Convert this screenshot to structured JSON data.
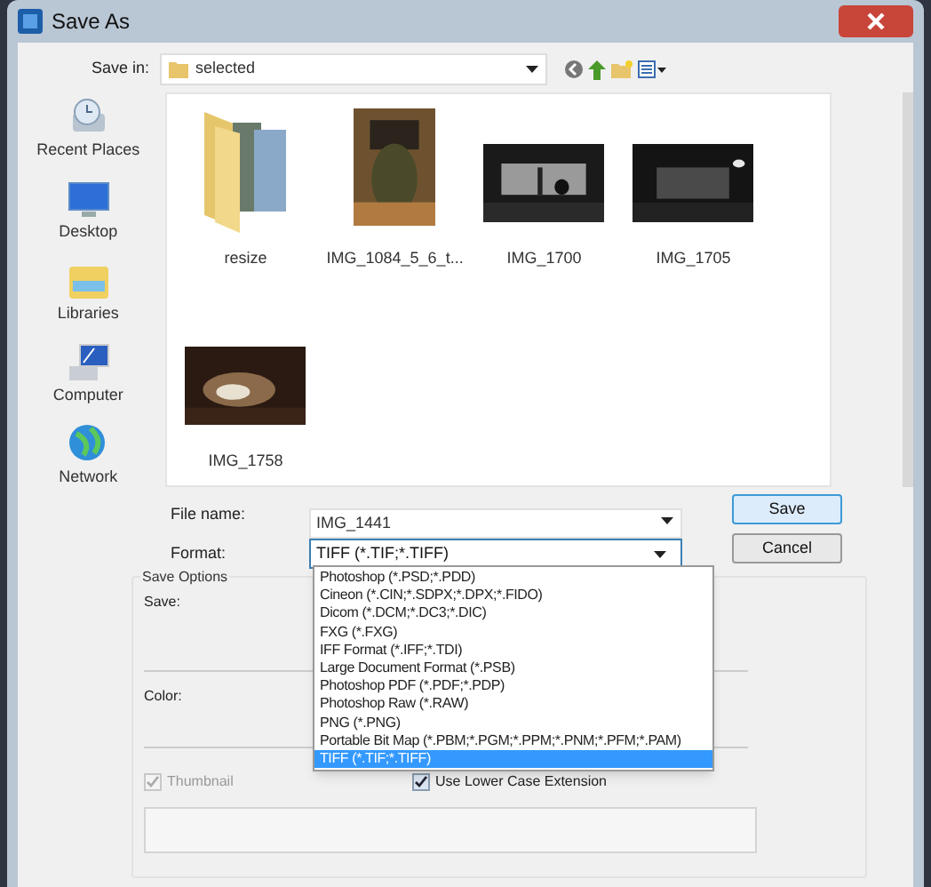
{
  "window": {
    "title": "Save As"
  },
  "save_in": {
    "label": "Save in:",
    "value": "selected"
  },
  "places": [
    {
      "label": "Recent Places",
      "kind": "recent"
    },
    {
      "label": "Desktop",
      "kind": "desktop"
    },
    {
      "label": "Libraries",
      "kind": "libraries"
    },
    {
      "label": "Computer",
      "kind": "computer"
    },
    {
      "label": "Network",
      "kind": "network"
    }
  ],
  "files": [
    {
      "name": "resize",
      "kind": "folder"
    },
    {
      "name": "IMG_1084_5_6_t...",
      "kind": "portrait"
    },
    {
      "name": "IMG_1700",
      "kind": "landscape"
    },
    {
      "name": "IMG_1705",
      "kind": "landscape"
    },
    {
      "name": "IMG_1758",
      "kind": "landscape"
    }
  ],
  "file_name": {
    "label": "File name:",
    "value": "IMG_1441"
  },
  "format": {
    "label": "Format:",
    "value": "TIFF (*.TIF;*.TIFF)",
    "expanded": true,
    "options": [
      {
        "label": "Photoshop (*.PSD;*.PDD)",
        "selected": false
      },
      {
        "label": "Cineon (*.CIN;*.SDPX;*.DPX;*.FIDO)",
        "selected": false
      },
      {
        "label": "Dicom (*.DCM;*.DC3;*.DIC)",
        "selected": false
      },
      {
        "label": "FXG (*.FXG)",
        "selected": false
      },
      {
        "label": "IFF Format (*.IFF;*.TDI)",
        "selected": false
      },
      {
        "label": "Large Document Format (*.PSB)",
        "selected": false
      },
      {
        "label": "Photoshop PDF (*.PDF;*.PDP)",
        "selected": false
      },
      {
        "label": "Photoshop Raw (*.RAW)",
        "selected": false
      },
      {
        "label": "PNG (*.PNG)",
        "selected": false
      },
      {
        "label": "Portable Bit Map (*.PBM;*.PGM;*.PPM;*.PNM;*.PFM;*.PAM)",
        "selected": false
      },
      {
        "label": "TIFF (*.TIF;*.TIFF)",
        "selected": true
      }
    ]
  },
  "buttons": [
    {
      "label": "Save",
      "default": true
    },
    {
      "label": "Cancel",
      "default": false
    }
  ],
  "save_options": {
    "title": "Save Options",
    "save_label": "Save:",
    "color_label": "Color:",
    "checkboxes": [
      {
        "label": "Thumbnail",
        "checked": true,
        "disabled": true
      },
      {
        "label": "Use Lower Case Extension",
        "checked": true,
        "disabled": false
      }
    ]
  }
}
